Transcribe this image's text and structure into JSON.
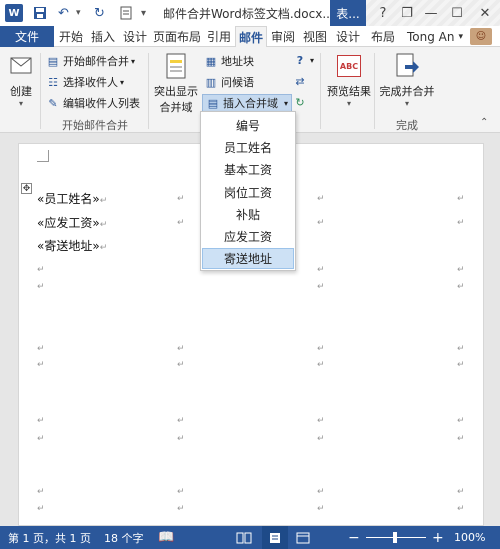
{
  "titlebar": {
    "app_icon_letter": "W",
    "title": "邮件合并Word标签文档.docx...",
    "context_tab": "表...",
    "help": "?",
    "restore": "❐",
    "minimize": "—",
    "maximize": "☐",
    "close": "✕"
  },
  "tabs": {
    "file": "文件",
    "items": [
      "开始",
      "插入",
      "设计",
      "页面布局",
      "引用",
      "邮件",
      "审阅",
      "视图",
      "设计",
      "布局"
    ],
    "active": "邮件",
    "user": "Tong An"
  },
  "ribbon": {
    "create": "创建",
    "start_mail_merge": "开始邮件合并",
    "select_recipients": "选择收件人",
    "edit_recipient_list": "编辑收件人列表",
    "group_start": "开始邮件合并",
    "highlight_fields_1": "突出显示",
    "highlight_fields_2": "合并域",
    "address_block": "地址块",
    "greeting_line": "问候语",
    "insert_merge_field": "插入合并域",
    "preview_results": "预览结果",
    "abc": "ABC",
    "finish_merge": "完成并合并",
    "group_finish": "完成"
  },
  "dropdown": {
    "items": [
      "编号",
      "员工姓名",
      "基本工资",
      "岗位工资",
      "补贴",
      "应发工资",
      "寄送地址"
    ],
    "hovered": "寄送地址"
  },
  "document": {
    "fields": [
      "«员工姓名»",
      "«应发工资»",
      "«寄送地址»"
    ],
    "paragraph_mark": "↵"
  },
  "statusbar": {
    "page": "第 1 页，共 1 页",
    "words": "18 个字",
    "zoom": "100%",
    "zoom_minus": "−",
    "zoom_plus": "+"
  },
  "colors": {
    "accent": "#2b579a",
    "hover": "#cde1f5"
  }
}
